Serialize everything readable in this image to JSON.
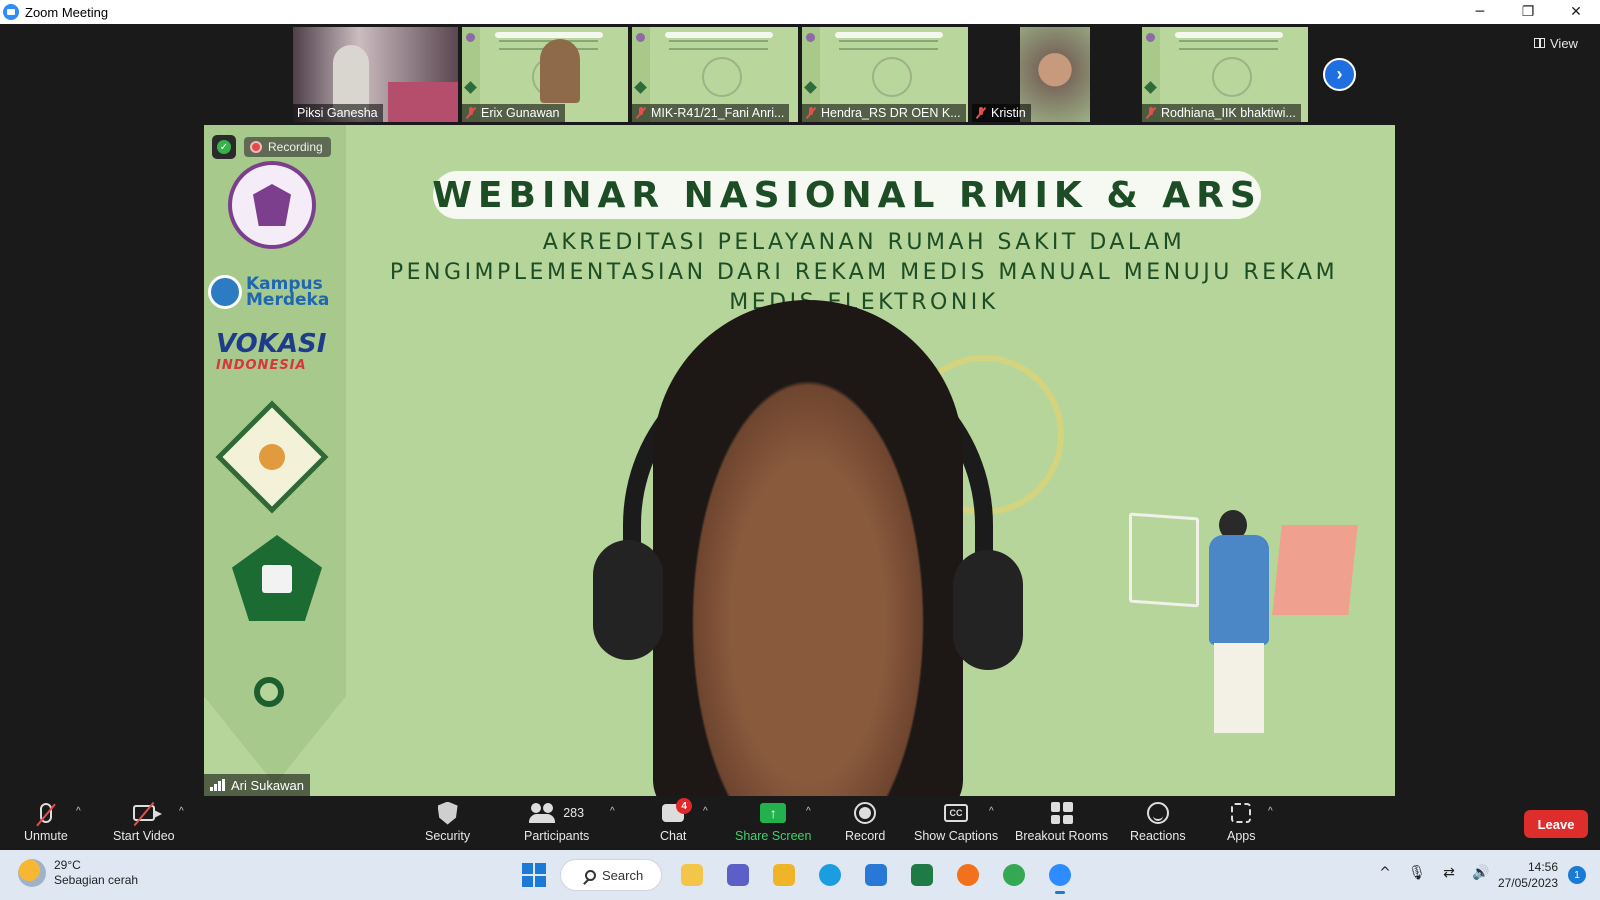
{
  "window": {
    "title": "Zoom Meeting",
    "controls": {
      "minimize": "─",
      "restore": "❐",
      "close": "✕"
    }
  },
  "gallery": {
    "participants": [
      {
        "name": "Piksi Ganesha",
        "muted": false
      },
      {
        "name": "Erix Gunawan",
        "muted": true
      },
      {
        "name": "MIK-R41/21_Fani Anri...",
        "muted": true
      },
      {
        "name": "Hendra_RS DR OEN K...",
        "muted": true
      },
      {
        "name": "Kristin",
        "muted": true
      },
      {
        "name": "Rodhiana_IIK bhaktiwi...",
        "muted": true
      }
    ],
    "next_icon": "›",
    "view_label": "View"
  },
  "main": {
    "recording_label": "Recording",
    "speaker_name": "Ari Sukawan",
    "slide": {
      "banner": "WEBINAR NASIONAL RMIK & ARS",
      "subtitle_line1": "AKREDITASI PELAYANAN RUMAH SAKIT DALAM",
      "subtitle_line2": "PENGIMPLEMENTASIAN DARI REKAM MEDIS MANUAL MENUJU REKAM",
      "subtitle_line3": "MEDIS ELEKTRONIK",
      "logo_kampus_line1": "Kampus",
      "logo_kampus_line2": "Merdeka",
      "logo_vokasi": "VOKASI",
      "logo_vokasi_sub": "INDONESIA"
    }
  },
  "toolbar": {
    "unmute": "Unmute",
    "start_video": "Start Video",
    "security": "Security",
    "participants": "Participants",
    "participants_count": "283",
    "chat": "Chat",
    "chat_badge": "4",
    "share_screen": "Share Screen",
    "share_glyph": "↑",
    "record": "Record",
    "captions": "Show Captions",
    "captions_glyph": "CC",
    "breakout": "Breakout Rooms",
    "reactions": "Reactions",
    "apps": "Apps",
    "leave": "Leave",
    "caret": "^"
  },
  "taskbar": {
    "temperature": "29°C",
    "weather": "Sebagian cerah",
    "search": "Search",
    "apps": [
      {
        "name": "file-explorer",
        "color": "#f3c64a"
      },
      {
        "name": "teams",
        "color": "#5b5fc7"
      },
      {
        "name": "folder",
        "color": "#f0b429"
      },
      {
        "name": "edge",
        "color": "#1b9de2"
      },
      {
        "name": "mail",
        "color": "#2a78d6"
      },
      {
        "name": "excel",
        "color": "#1e7b45"
      },
      {
        "name": "firefox",
        "color": "#f2711c"
      },
      {
        "name": "chrome",
        "color": "#34a853"
      },
      {
        "name": "zoom",
        "color": "#2d8cff"
      }
    ],
    "tray_up": "^",
    "time": "14:56",
    "date": "27/05/2023",
    "notifications": "1"
  }
}
